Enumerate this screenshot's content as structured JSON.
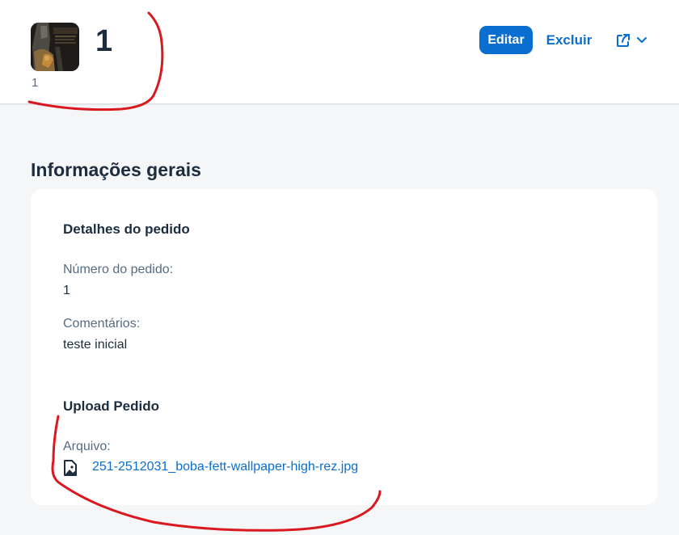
{
  "header": {
    "title": "1",
    "subtitle": "1",
    "avatar_icon": "boba-fett-thumbnail-image",
    "actions": {
      "edit_label": "Editar",
      "delete_label": "Excluir",
      "share_icon": "share-icon",
      "menu_icon": "chevron-down-icon"
    }
  },
  "section": {
    "title": "Informações gerais"
  },
  "order_details": {
    "group_title": "Detalhes do pedido",
    "order_number_label": "Número do pedido:",
    "order_number_value": "1",
    "comments_label": "Comentários:",
    "comments_value": "teste inicial"
  },
  "upload": {
    "group_title": "Upload Pedido",
    "file_label": "Arquivo:",
    "file_name": "251-2512031_boba-fett-wallpaper-high-rez.jpg",
    "file_icon": "image-file-icon"
  },
  "colors": {
    "accent": "#0a6ed1",
    "annotation": "#d9181f",
    "text": "#1d2d3e",
    "label": "#556b82",
    "background": "#f5f6f7"
  }
}
